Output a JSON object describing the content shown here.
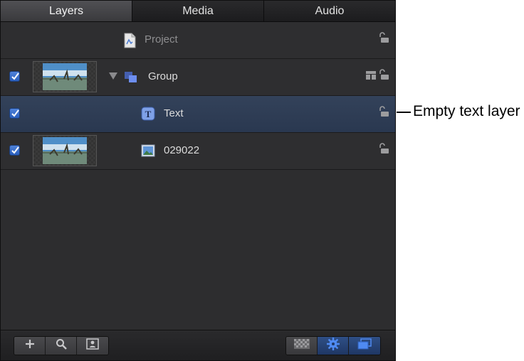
{
  "tabs": [
    {
      "label": "Layers",
      "active": true
    },
    {
      "label": "Media",
      "active": false
    },
    {
      "label": "Audio",
      "active": false
    }
  ],
  "layers": {
    "project": {
      "label": "Project",
      "icon": "project-document-icon"
    },
    "group": {
      "label": "Group",
      "icon": "group-stack-icon",
      "checked": true
    },
    "text": {
      "label": "Text",
      "icon": "text-layer-icon",
      "checked": true
    },
    "image": {
      "label": "029022",
      "icon": "image-layer-icon",
      "checked": true
    }
  },
  "toolbar": {
    "left": [
      "add-icon",
      "search-icon",
      "portrait-icon"
    ],
    "right": [
      "checkerboard-icon",
      "gear-icon",
      "layers-icon"
    ]
  },
  "callout": {
    "text": "Empty text layer"
  },
  "colors": {
    "selected_row": "#2f3e56",
    "accent": "#3d6fd1"
  }
}
